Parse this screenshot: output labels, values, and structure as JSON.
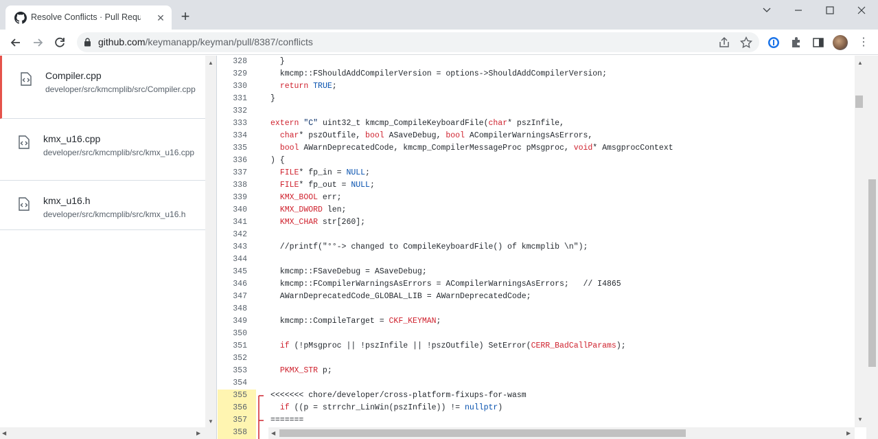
{
  "browser": {
    "tab_title": "Resolve Conflicts · Pull Request #",
    "tab_close": "✕",
    "new_tab": "+",
    "url_host": "github.com",
    "url_path": "/keymanapp/keyman/pull/8387/conflicts"
  },
  "files": [
    {
      "name": "Compiler.cpp",
      "path": "developer/src/kmcmplib/src/Compiler.cpp",
      "active": true
    },
    {
      "name": "kmx_u16.cpp",
      "path": "developer/src/kmcmplib/src/kmx_u16.cpp",
      "active": false
    },
    {
      "name": "kmx_u16.h",
      "path": "developer/src/kmcmplib/src/kmx_u16.h",
      "active": false
    }
  ],
  "code_lines": [
    {
      "n": "328",
      "code": "  }"
    },
    {
      "n": "329",
      "code": "  kmcmp::FShouldAddCompilerVersion = options->ShouldAddCompilerVersion;"
    },
    {
      "n": "330",
      "code": "  return TRUE;"
    },
    {
      "n": "331",
      "code": "}"
    },
    {
      "n": "332",
      "code": ""
    },
    {
      "n": "333",
      "code": "extern \"C\" uint32_t kmcmp_CompileKeyboardFile(char* pszInfile,"
    },
    {
      "n": "334",
      "code": "  char* pszOutfile, bool ASaveDebug, bool ACompilerWarningsAsErrors,"
    },
    {
      "n": "335",
      "code": "  bool AWarnDeprecatedCode, kmcmp_CompilerMessageProc pMsgproc, void* AmsgprocContext"
    },
    {
      "n": "336",
      "code": ") {"
    },
    {
      "n": "337",
      "code": "  FILE* fp_in = NULL;"
    },
    {
      "n": "338",
      "code": "  FILE* fp_out = NULL;"
    },
    {
      "n": "339",
      "code": "  KMX_BOOL err;"
    },
    {
      "n": "340",
      "code": "  KMX_DWORD len;"
    },
    {
      "n": "341",
      "code": "  KMX_CHAR str[260];"
    },
    {
      "n": "342",
      "code": ""
    },
    {
      "n": "343",
      "code": "  //printf(\"°°-> changed to CompileKeyboardFile() of kmcmplib \\n\");"
    },
    {
      "n": "344",
      "code": ""
    },
    {
      "n": "345",
      "code": "  kmcmp::FSaveDebug = ASaveDebug;"
    },
    {
      "n": "346",
      "code": "  kmcmp::FCompilerWarningsAsErrors = ACompilerWarningsAsErrors;   // I4865"
    },
    {
      "n": "347",
      "code": "  AWarnDeprecatedCode_GLOBAL_LIB = AWarnDeprecatedCode;"
    },
    {
      "n": "348",
      "code": ""
    },
    {
      "n": "349",
      "code": "  kmcmp::CompileTarget = CKF_KEYMAN;"
    },
    {
      "n": "350",
      "code": ""
    },
    {
      "n": "351",
      "code": "  if (!pMsgproc || !pszInfile || !pszOutfile) SetError(CERR_BadCallParams);"
    },
    {
      "n": "352",
      "code": ""
    },
    {
      "n": "353",
      "code": "  PKMX_STR p;"
    },
    {
      "n": "354",
      "code": ""
    },
    {
      "n": "355",
      "code": "<<<<<<< chore/developer/cross-platform-fixups-for-wasm",
      "conflict": true
    },
    {
      "n": "356",
      "code": "  if ((p = strrchr_LinWin(pszInfile)) != nullptr)",
      "conflict": true
    },
    {
      "n": "357",
      "code": "=======",
      "conflict": true
    },
    {
      "n": "358",
      "code": "",
      "conflict": true
    }
  ]
}
